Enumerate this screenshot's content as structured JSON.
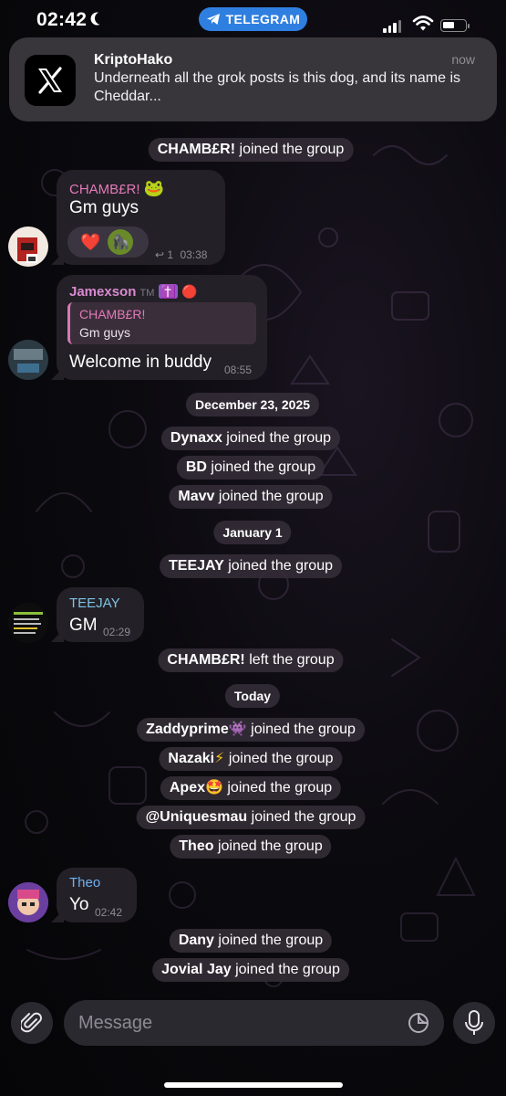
{
  "status_bar": {
    "time": "02:42",
    "app_pill": "TELEGRAM"
  },
  "notification": {
    "app_icon": "x-logo-icon",
    "title": "KriptoHako",
    "time": "now",
    "body": "Underneath all the grok posts is this dog, and its name is Cheddar..."
  },
  "events": {
    "chamber_joined": {
      "name": "CHAMB£R!",
      "text": "joined the group"
    },
    "date_1": "December 23, 2025",
    "dynaxx": {
      "name": "Dynaxx",
      "text": "joined the group"
    },
    "bd": {
      "name": "BD",
      "text": "joined the group"
    },
    "mavv": {
      "name": "Mavv",
      "text": "joined the group"
    },
    "date_2": "January 1",
    "teejay": {
      "name": "TEEJAY",
      "text": "joined the group"
    },
    "chamber_left": {
      "name": "CHAMB£R!",
      "text": "left the group"
    },
    "date_3": "Today",
    "zaddy": {
      "name": "Zaddyprime",
      "emoji": "👾",
      "text": "joined the group"
    },
    "nazaki": {
      "name": "Nazaki",
      "emoji": "⚡",
      "text": "joined the group"
    },
    "apex": {
      "name": "Apex",
      "emoji": "🤩",
      "text": "joined the group"
    },
    "uniques": {
      "name": "@Uniquesmau",
      "text": "joined the group"
    },
    "theo": {
      "name": "Theo",
      "text": "joined the group"
    },
    "dany": {
      "name": "Dany",
      "text": "joined the group"
    },
    "jovial": {
      "name": "Jovial Jay",
      "text": "joined the group"
    }
  },
  "messages": {
    "chamber": {
      "sender": "CHAMB£R!",
      "sender_emoji": "🐸",
      "sender_color": "#e27ab8",
      "text": "Gm guys",
      "reactions": [
        "❤️",
        "🦍"
      ],
      "reply_count": "1",
      "time": "03:38"
    },
    "jamexson": {
      "sender": "Jamexson",
      "sender_badge": "TM",
      "sender_emoji_1": "✝️",
      "sender_emoji_2": "🔴",
      "sender_color": "#d88ad0",
      "quote_sender": "CHAMB£R!",
      "quote_text": "Gm guys",
      "text": "Welcome in buddy",
      "time": "08:55"
    },
    "teejay": {
      "sender": "TEEJAY",
      "sender_color": "#7dc3e6",
      "text": "GM",
      "time": "02:29"
    },
    "theo": {
      "sender": "Theo",
      "sender_color": "#6fb1f0",
      "text": "Yo",
      "time": "02:42"
    }
  },
  "input": {
    "placeholder": "Message"
  }
}
